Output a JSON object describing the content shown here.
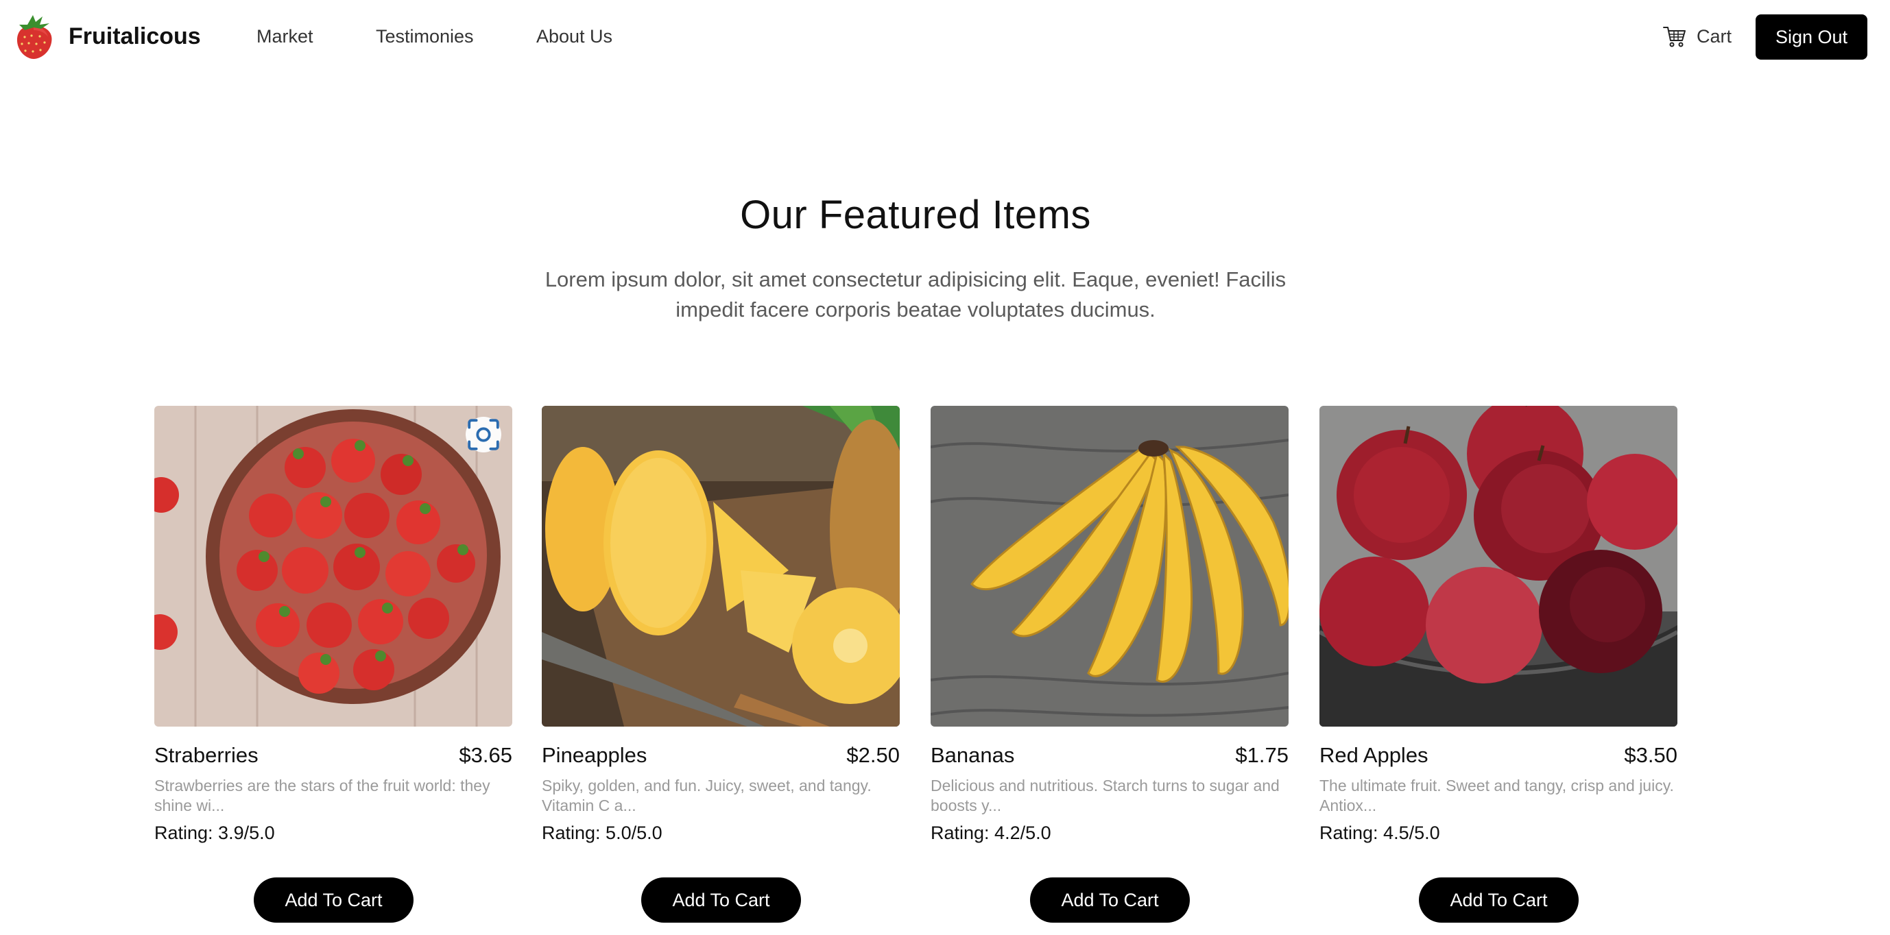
{
  "header": {
    "brand": "Fruitalicous",
    "nav": [
      {
        "label": "Market"
      },
      {
        "label": "Testimonies"
      },
      {
        "label": "About Us"
      }
    ],
    "cart_label": "Cart",
    "sign_out_label": "Sign Out",
    "logo_icon": "strawberry-icon",
    "cart_icon": "shopping-cart-icon"
  },
  "hero": {
    "title": "Our Featured Items",
    "subtitle": "Lorem ipsum dolor, sit amet consectetur adipisicing elit. Eaque, eveniet! Facilis impedit facere corporis beatae voluptates ducimus."
  },
  "products": [
    {
      "name": "Straberries",
      "price": "$3.65",
      "description": "Strawberries are the stars of the fruit world: they shine wi...",
      "rating": "Rating: 3.9/5.0",
      "button": "Add To Cart",
      "image": "strawberries-bowl-photo"
    },
    {
      "name": "Pineapples",
      "price": "$2.50",
      "description": "Spiky, golden, and fun. Juicy, sweet, and tangy. Vitamin C a...",
      "rating": "Rating: 5.0/5.0",
      "button": "Add To Cart",
      "image": "sliced-pineapple-photo"
    },
    {
      "name": "Bananas",
      "price": "$1.75",
      "description": "Delicious and nutritious. Starch turns to sugar and boosts y...",
      "rating": "Rating: 4.2/5.0",
      "button": "Add To Cart",
      "image": "banana-bunch-photo"
    },
    {
      "name": "Red Apples",
      "price": "$3.50",
      "description": "The ultimate fruit. Sweet and tangy, crisp and juicy. Antiox...",
      "rating": "Rating: 4.5/5.0",
      "button": "Add To Cart",
      "image": "red-apples-bowl-photo"
    }
  ],
  "colors": {
    "primary_button": "#000000",
    "button_text": "#ffffff",
    "muted_text": "#9a9a9a",
    "subtitle_text": "#5a5a5a"
  }
}
